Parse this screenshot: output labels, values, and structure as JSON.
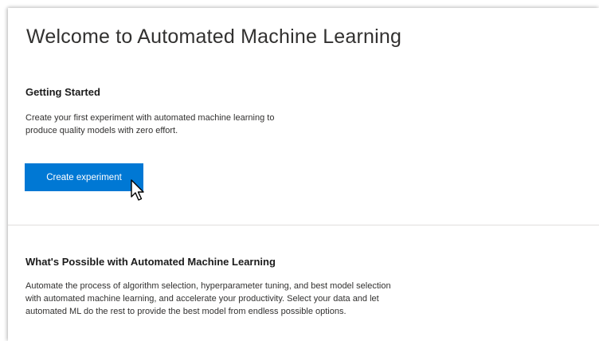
{
  "page": {
    "title": "Welcome to Automated Machine Learning"
  },
  "getting_started": {
    "heading": "Getting Started",
    "line1": "Create your first experiment with automated machine learning to",
    "line2": "produce quality models with zero effort.",
    "button_label": "Create experiment"
  },
  "possible": {
    "heading": "What's Possible with Automated Machine Learning",
    "line1": "Automate the process of algorithm selection, hyperparameter tuning, and best model selection",
    "line2": "with automated machine learning, and accelerate your productivity. Select your data and let",
    "line3": "automated ML do the rest to provide the best model from endless possible options."
  },
  "colors": {
    "accent": "#0078d4",
    "divider": "#e1dfdd"
  },
  "icons": {
    "cursor": "mouse-pointer-icon"
  }
}
